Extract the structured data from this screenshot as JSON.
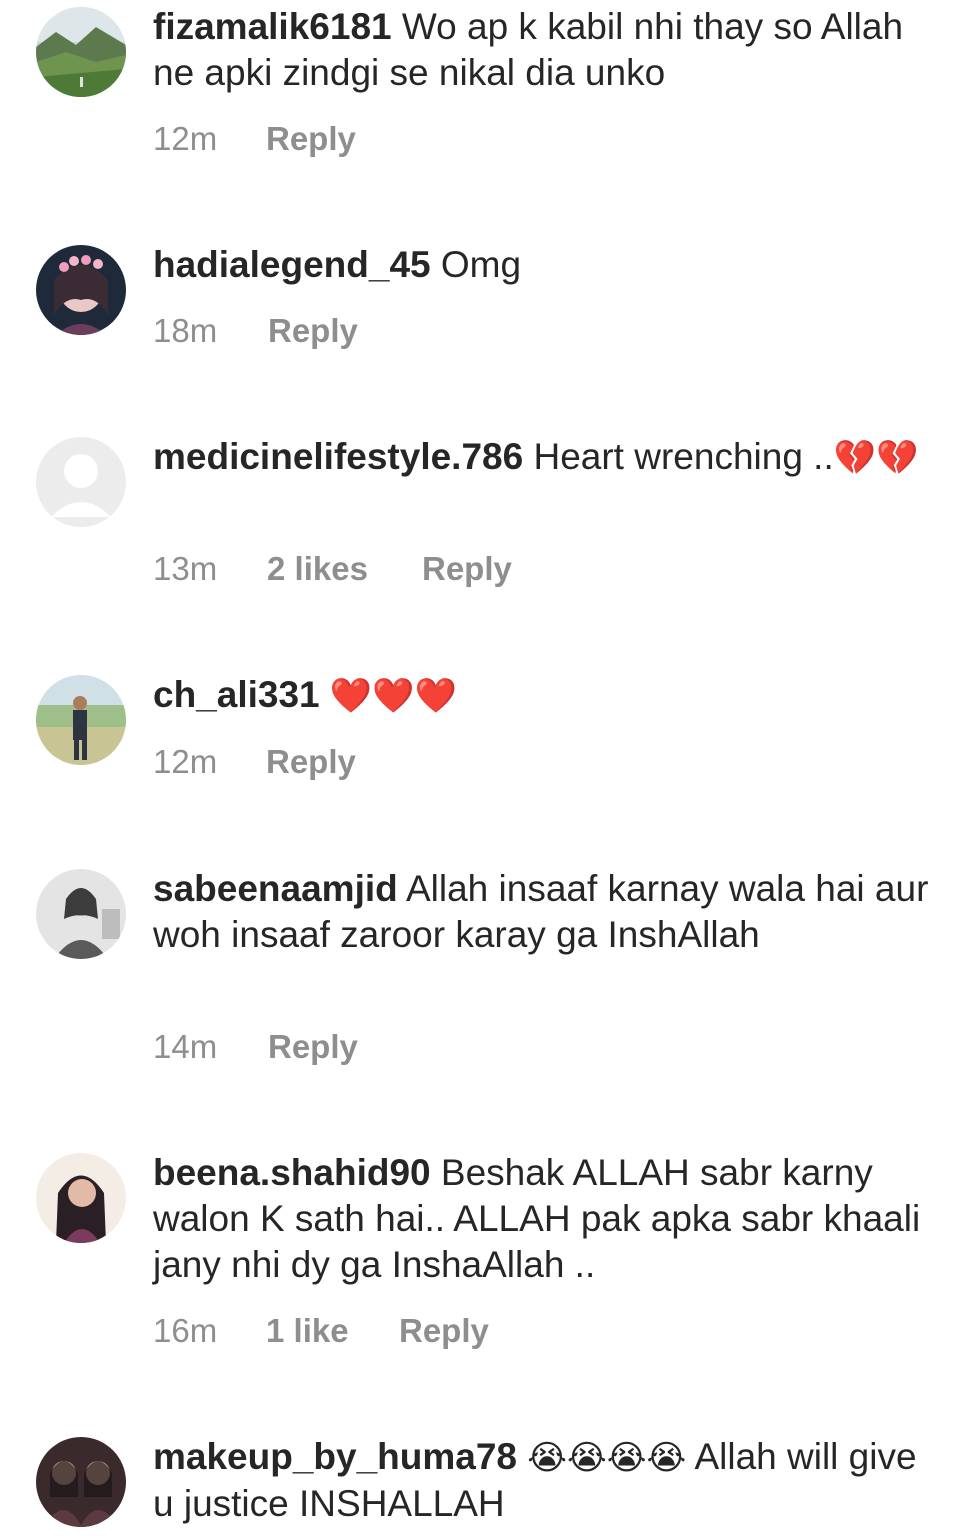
{
  "comments": [
    {
      "username": "fizamalik6181",
      "text": "Wo ap k kabil nhi thay so Allah ne apki zindgi se nikal dia unko",
      "emoji": "",
      "time": "12m",
      "likes": "",
      "reply": "Reply"
    },
    {
      "username": "hadialegend_45",
      "text": "Omg",
      "emoji": "",
      "time": "18m",
      "likes": "",
      "reply": "Reply"
    },
    {
      "username": "medicinelifestyle.786",
      "text": "Heart wrenching ..",
      "emoji": "💔💔",
      "time": "13m",
      "likes": "2 likes",
      "reply": "Reply"
    },
    {
      "username": "ch_ali331",
      "text": "",
      "emoji": "❤️❤️❤️",
      "time": "12m",
      "likes": "",
      "reply": "Reply"
    },
    {
      "username": "sabeenaamjid",
      "text": "Allah insaaf karnay wala hai aur woh insaaf zaroor karay ga InshAllah",
      "emoji": "",
      "time": "14m",
      "likes": "",
      "reply": "Reply"
    },
    {
      "username": "beena.shahid90",
      "text": "Beshak ALLAH sabr karny walon K sath hai.. ALLAH pak apka sabr khaali jany nhi dy ga InshaAllah ..",
      "emoji": "",
      "time": "16m",
      "likes": "1 like",
      "reply": "Reply"
    },
    {
      "username": "makeup_by_huma78",
      "text": "Allah will give u justice INSHALLAH",
      "emoji": "😭😭😭😭",
      "time": "",
      "likes": "",
      "reply": ""
    }
  ]
}
